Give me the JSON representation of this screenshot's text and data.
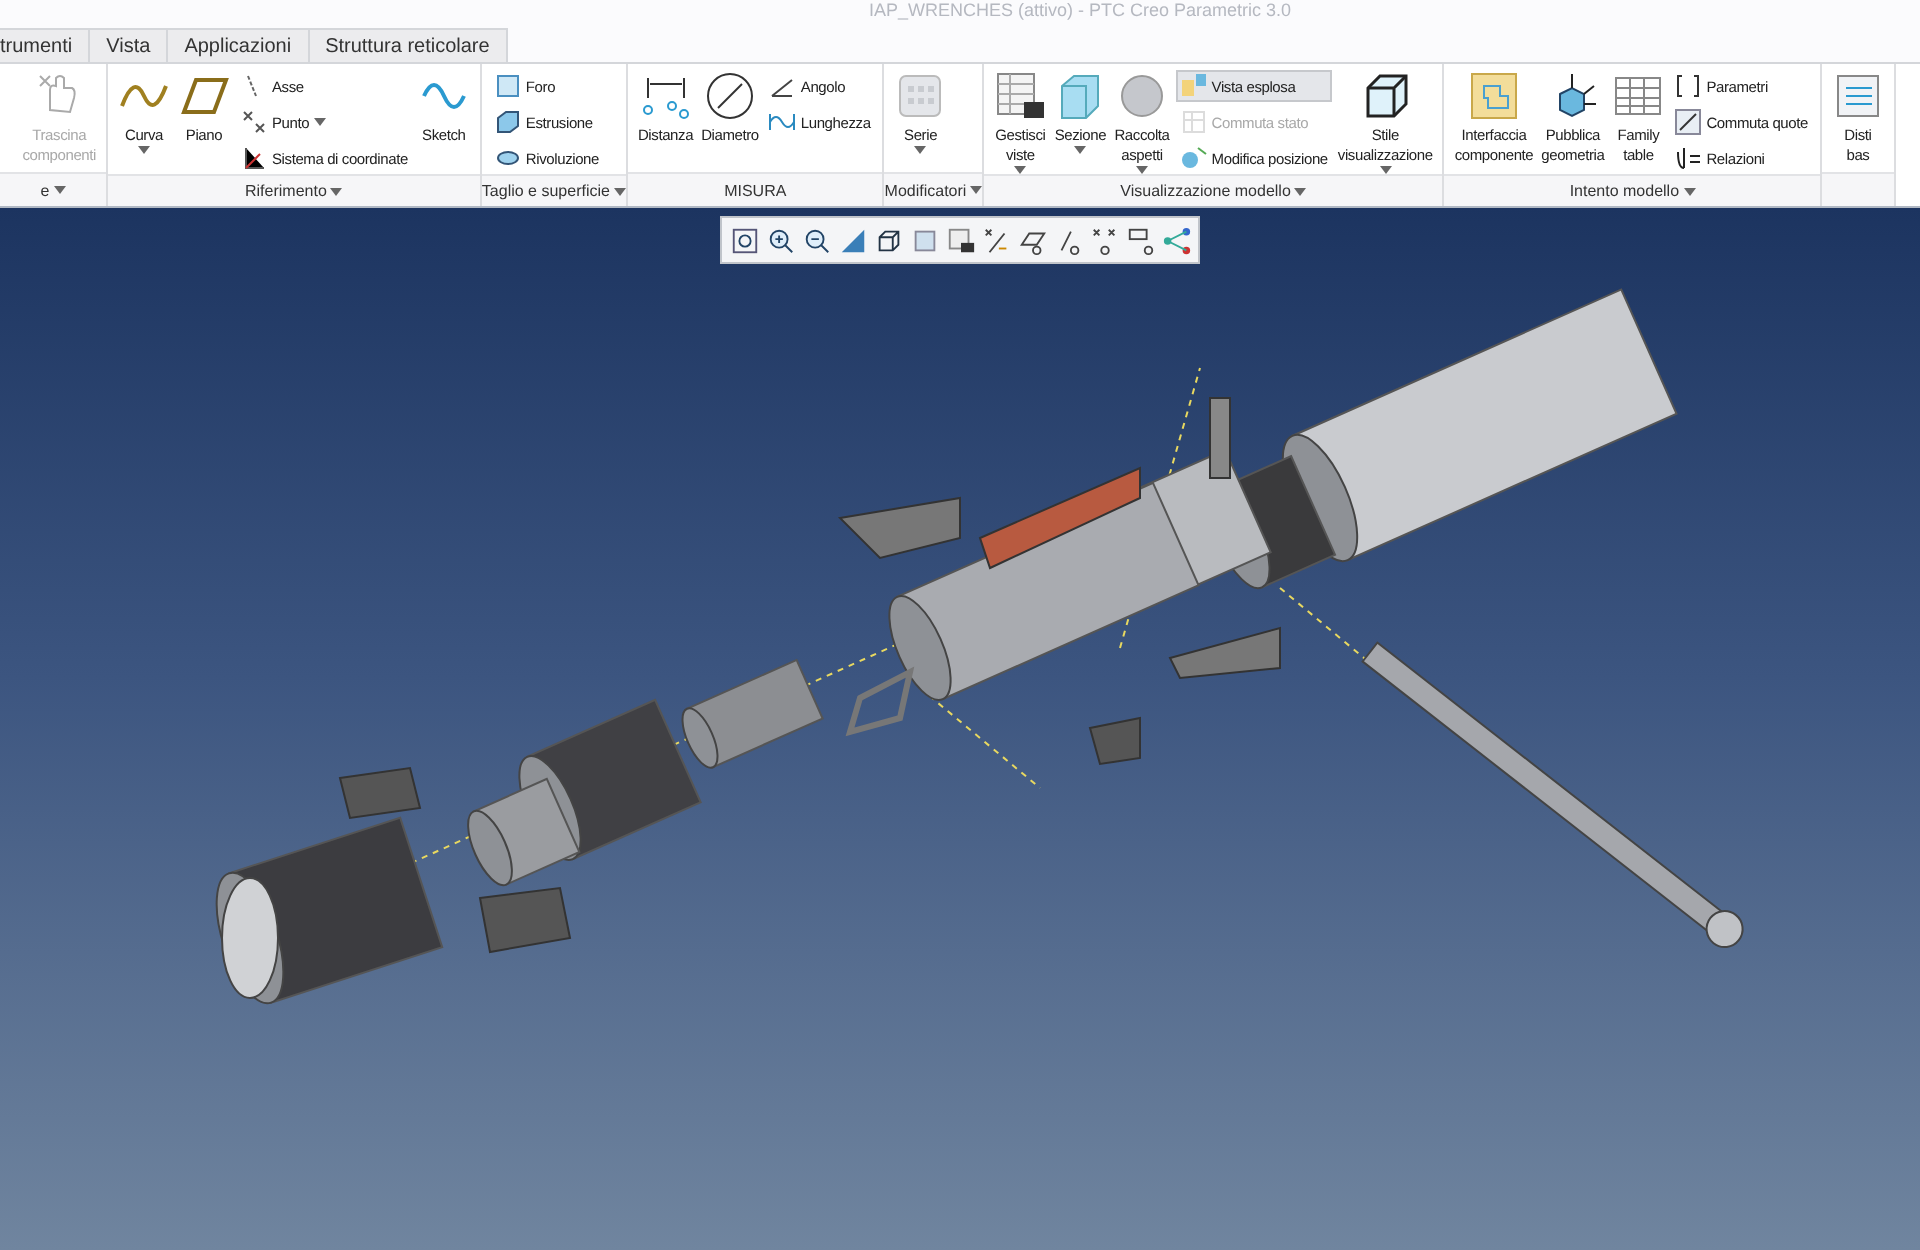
{
  "window": {
    "title": "IAP_WRENCHES (attivo) - PTC Creo Parametric 3.0"
  },
  "tabs": [
    {
      "label": "trumenti",
      "selected": false
    },
    {
      "label": "Vista",
      "selected": false
    },
    {
      "label": "Applicazioni",
      "selected": false
    },
    {
      "label": "Struttura reticolare",
      "selected": false
    }
  ],
  "ribbon": {
    "groups": [
      {
        "label": "e",
        "caret": true,
        "items": [
          {
            "kind": "large",
            "lines": [
              "Trascina",
              "componenti"
            ],
            "caret": false,
            "disabled": true
          }
        ]
      },
      {
        "label": "Riferimento",
        "caret": true,
        "items": [
          {
            "kind": "large",
            "lines": [
              "Curva"
            ],
            "caret": true,
            "disabled": false
          },
          {
            "kind": "large",
            "lines": [
              "Piano"
            ],
            "caret": false,
            "disabled": false
          },
          {
            "kind": "stack",
            "entries": [
              {
                "label": "Asse",
                "caret": false,
                "disabled": false,
                "selected": false
              },
              {
                "label": "Punto",
                "caret": true,
                "disabled": false,
                "selected": false
              },
              {
                "label": "Sistema di coordinate",
                "caret": false,
                "disabled": false,
                "selected": false
              }
            ]
          },
          {
            "kind": "large",
            "lines": [
              "Sketch"
            ],
            "caret": false,
            "disabled": false
          }
        ]
      },
      {
        "label": "Taglio e superficie",
        "caret": true,
        "items": [
          {
            "kind": "stack",
            "entries": [
              {
                "label": "Foro",
                "caret": false,
                "disabled": false,
                "selected": false
              },
              {
                "label": "Estrusione",
                "caret": false,
                "disabled": false,
                "selected": false
              },
              {
                "label": "Rivoluzione",
                "caret": false,
                "disabled": false,
                "selected": false
              }
            ]
          }
        ]
      },
      {
        "label": "MISURA",
        "caret": false,
        "items": [
          {
            "kind": "large",
            "lines": [
              "Distanza"
            ],
            "caret": false,
            "disabled": false
          },
          {
            "kind": "large",
            "lines": [
              "Diametro"
            ],
            "caret": false,
            "disabled": false
          },
          {
            "kind": "stack",
            "entries": [
              {
                "label": "Angolo",
                "caret": false,
                "disabled": false,
                "selected": false
              },
              {
                "label": "Lunghezza",
                "caret": false,
                "disabled": false,
                "selected": false
              }
            ]
          }
        ]
      },
      {
        "label": "Modificatori",
        "caret": true,
        "items": [
          {
            "kind": "large",
            "lines": [
              "Serie"
            ],
            "caret": true,
            "disabled": false
          }
        ]
      },
      {
        "label": "Visualizzazione modello",
        "caret": true,
        "items": [
          {
            "kind": "large",
            "lines": [
              "Gestisci",
              "viste"
            ],
            "caret": true,
            "disabled": false
          },
          {
            "kind": "large",
            "lines": [
              "Sezione"
            ],
            "caret": true,
            "disabled": false
          },
          {
            "kind": "large",
            "lines": [
              "Raccolta",
              "aspetti"
            ],
            "caret": true,
            "disabled": false
          },
          {
            "kind": "stack",
            "entries": [
              {
                "label": "Vista esplosa",
                "caret": false,
                "disabled": false,
                "selected": true
              },
              {
                "label": "Commuta stato",
                "caret": false,
                "disabled": true,
                "selected": false
              },
              {
                "label": "Modifica posizione",
                "caret": false,
                "disabled": false,
                "selected": false
              }
            ]
          },
          {
            "kind": "large",
            "lines": [
              "Stile",
              "visualizzazione"
            ],
            "caret": true,
            "disabled": false
          }
        ]
      },
      {
        "label": "Intento modello",
        "caret": true,
        "items": [
          {
            "kind": "large",
            "lines": [
              "Interfaccia",
              "componente"
            ],
            "caret": false,
            "disabled": false
          },
          {
            "kind": "large",
            "lines": [
              "Pubblica",
              "geometria"
            ],
            "caret": false,
            "disabled": false
          },
          {
            "kind": "large",
            "lines": [
              "Family",
              "table"
            ],
            "caret": false,
            "disabled": false
          },
          {
            "kind": "stack",
            "entries": [
              {
                "label": "Parametri",
                "caret": false,
                "disabled": false,
                "selected": false
              },
              {
                "label": "Commuta quote",
                "caret": false,
                "disabled": false,
                "selected": false
              },
              {
                "label": "Relazioni",
                "caret": false,
                "disabled": false,
                "selected": false
              }
            ]
          }
        ]
      },
      {
        "items": [
          {
            "kind": "large",
            "lines": [
              "Disti",
              "bas"
            ],
            "caret": false,
            "disabled": false
          }
        ]
      }
    ]
  }
}
